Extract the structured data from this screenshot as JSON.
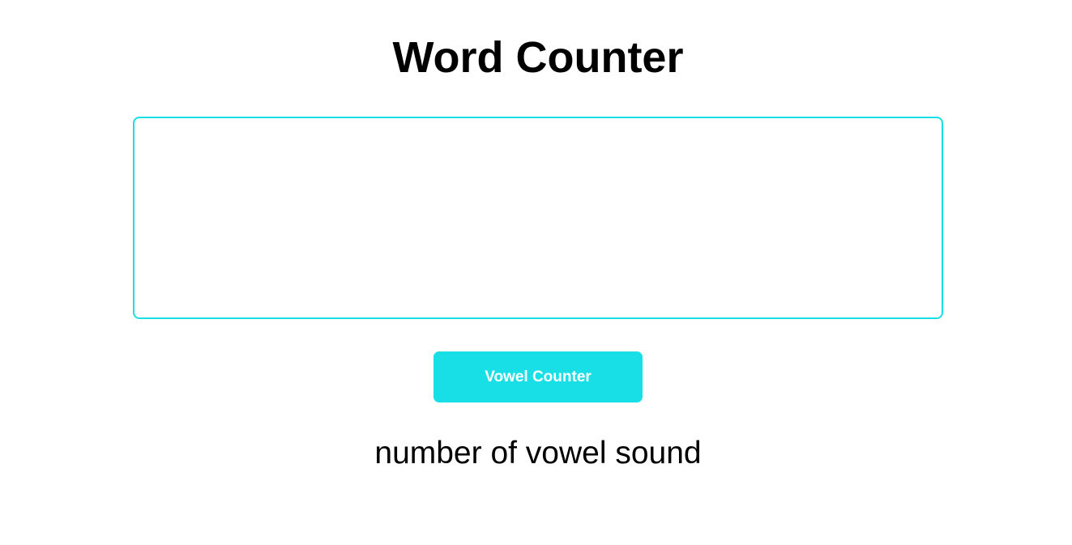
{
  "header": {
    "title": "Word Counter"
  },
  "input": {
    "value": "",
    "placeholder": ""
  },
  "button": {
    "label": "Vowel Counter"
  },
  "result": {
    "text": "number of vowel sound"
  },
  "colors": {
    "accent": "#18dfe6",
    "button_bg": "#18dfe6",
    "button_text": "#ffffff",
    "text": "#000000",
    "background": "#ffffff"
  }
}
